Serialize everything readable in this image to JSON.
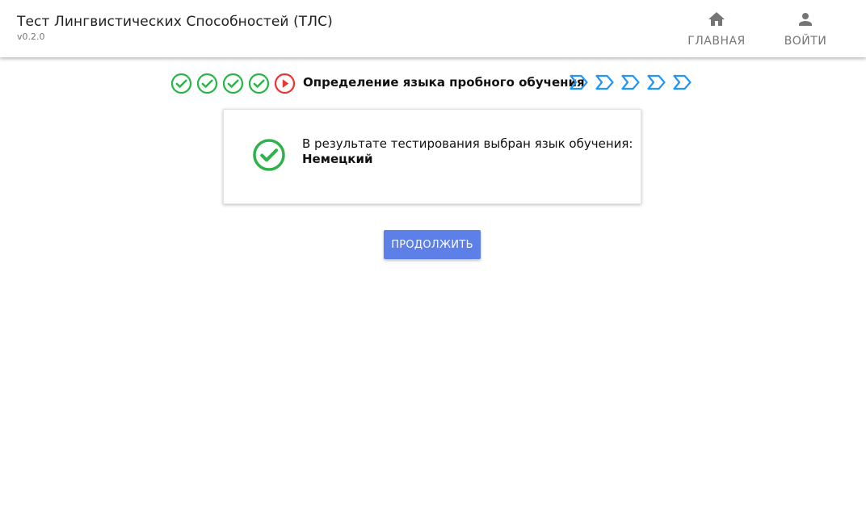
{
  "app": {
    "title": "Тест Лингвистических Способностей (ТЛС)",
    "version": "v0.2.0"
  },
  "nav": {
    "home_label": "ГЛАВНАЯ",
    "home_icon": "home-icon",
    "login_label": "ВОЙТИ",
    "login_icon": "person-icon"
  },
  "stepper": {
    "completed_steps": 5,
    "current_step_label": "Определение языка пробного обучения",
    "upcoming_steps": 5,
    "colors": {
      "done": "#2fb24c",
      "current": "#e53935",
      "upcoming": "#2196f3"
    }
  },
  "result": {
    "message": "В результате тестирования выбран язык обучения:",
    "language": "Немецкий",
    "icon": "check-circle-icon"
  },
  "actions": {
    "continue_label": "ПРОДОЛЖИТЬ",
    "button_color": "#5c7fe8"
  }
}
